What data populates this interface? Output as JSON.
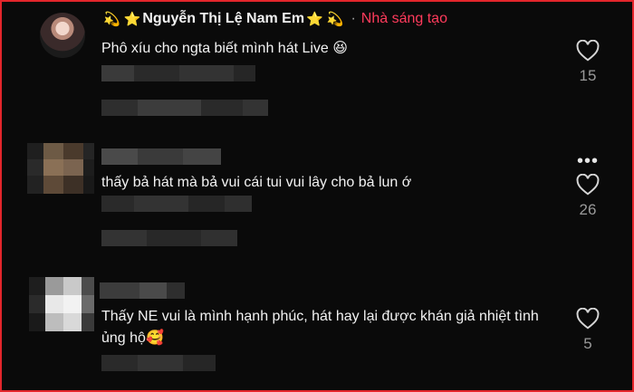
{
  "comments": [
    {
      "username": "Nguyễn Thị Lệ Nam Em",
      "badge": "Nhà sáng tạo",
      "separator": "·",
      "text": "Phô xíu cho ngta biết mình hát Live 😆",
      "likes": "15"
    },
    {
      "text": "thấy bả hát mà bả vui cái tui vui lây cho bả lun ớ",
      "likes": "26"
    },
    {
      "text": "Thấy NE vui là mình hạnh phúc, hát hay lại được khán giả nhiệt tình ủng hộ🥰",
      "likes": "5"
    }
  ],
  "colors": {
    "frame_border": "#e3262b",
    "background": "#0a0a0a",
    "creator_badge": "#ff3b5c"
  },
  "icons": [
    "heart-icon",
    "more-options-icon",
    "star-icon",
    "sparkle-icon"
  ]
}
